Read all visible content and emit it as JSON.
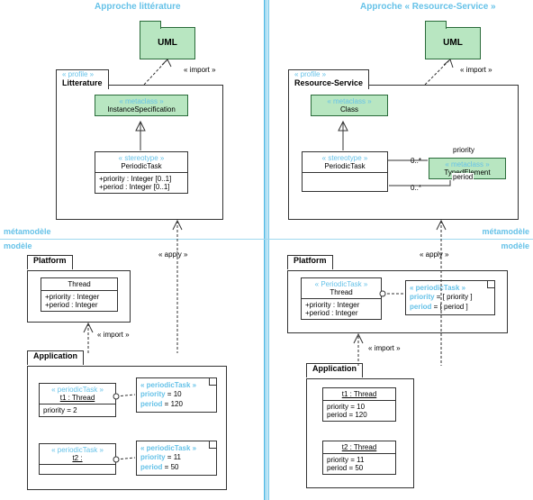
{
  "titles": {
    "left": "Approche littérature",
    "right": "Approche « Resource-Service »"
  },
  "meta": {
    "top": "métamodèle",
    "bottom": "modèle"
  },
  "uml": "UML",
  "profile_st": "« profile »",
  "import_lbl": "« import »",
  "apply_lbl": "« apply »",
  "left": {
    "profile_name": "Litterature",
    "meta_st": "« metaclass »",
    "meta_name": "InstanceSpecification",
    "stereo_st": "« stereotype »",
    "stereo_name": "PeriodicTask",
    "attr1": "+priority : Integer [0..1]",
    "attr2": "+period : Integer [0..1]",
    "platform": "Platform",
    "thread_name": "Thread",
    "thread_a1": "+priority : Integer",
    "thread_a2": "+period : Integer",
    "application": "Application",
    "inst1_st": "« periodicTask »",
    "inst1_name": "t1 : Thread",
    "inst1_attr": "priority = 2",
    "note1_st": "« periodicTask »",
    "note1_l1": "priority =  10",
    "note1_l2": "period = 120",
    "inst2_st": "« periodicTask »",
    "inst2_name": "t2 :",
    "note2_st": "« periodicTask »",
    "note2_l1": "priority =  11",
    "note2_l2": "period = 50"
  },
  "right": {
    "profile_name": "Resource-Service",
    "meta1_st": "« metaclass »",
    "meta1_name": "Class",
    "meta2_st": "« metaclass »",
    "meta2_name": "TypedElement",
    "stereo_st": "« stereotype »",
    "stereo_name": "PeriodicTask",
    "assoc1": "priority",
    "assoc2": "period",
    "mult": "0..*",
    "platform": "Platform",
    "thread_st": "« PeriodicTask »",
    "thread_name": "Thread",
    "thread_a1": "+priority : Integer",
    "thread_a2": "+period : Integer",
    "note_st": "« periodicTask »",
    "note_l1": "priority =  [ priority ]",
    "note_l2": "period = [ period ]",
    "application": "Application",
    "inst1_name": "t1 : Thread",
    "inst1_a1": "priority = 10",
    "inst1_a2": "period = 120",
    "inst2_name": "t2 : Thread",
    "inst2_a1": "priority = 11",
    "inst2_a2": "period = 50"
  }
}
